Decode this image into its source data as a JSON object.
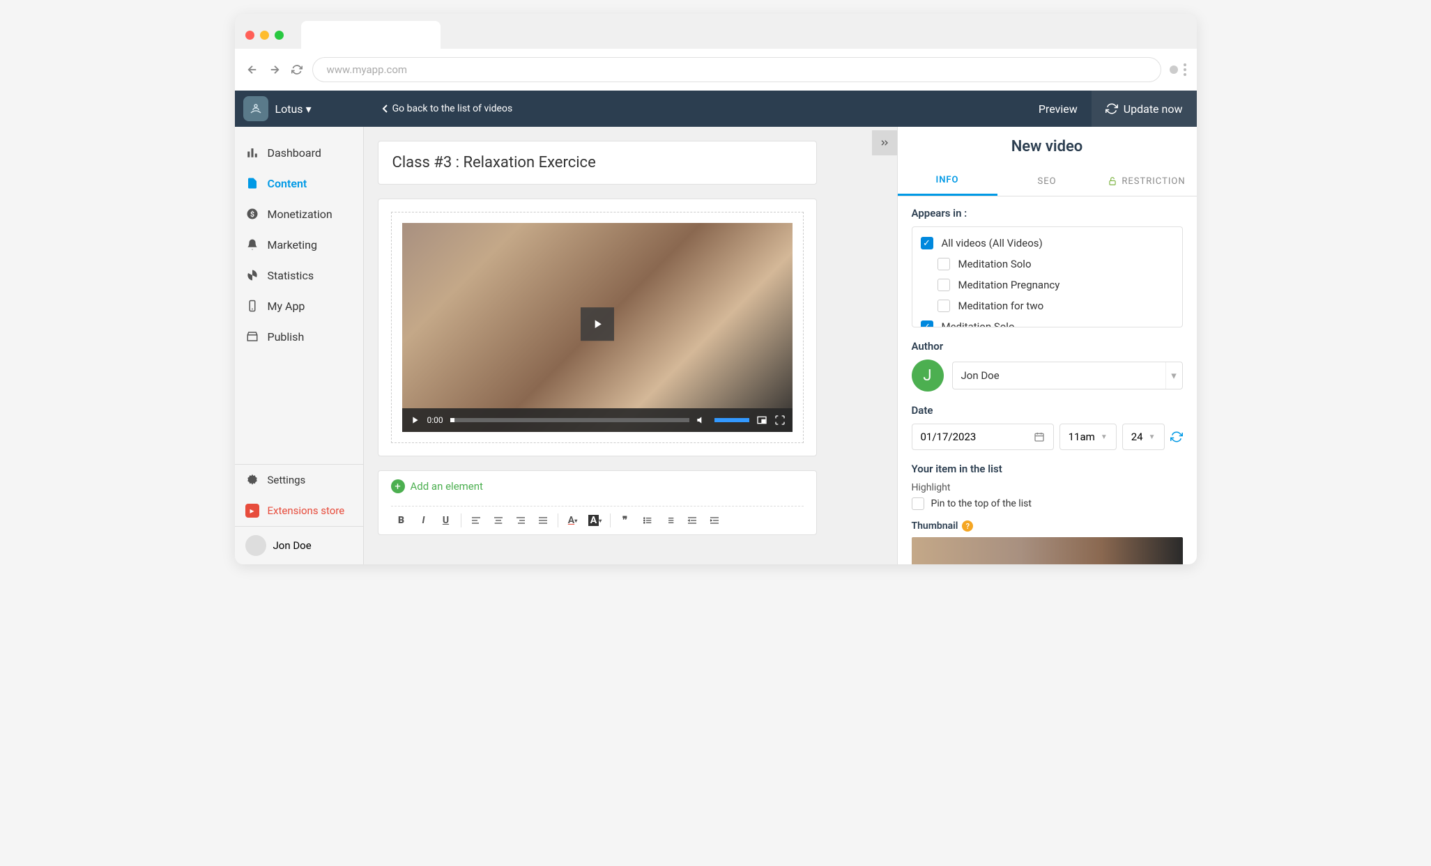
{
  "browser": {
    "url": "www.myapp.com"
  },
  "topbar": {
    "app_name": "Lotus",
    "back_link": "Go back to the list of videos",
    "preview": "Preview",
    "update": "Update now"
  },
  "sidebar": {
    "items": [
      {
        "label": "Dashboard",
        "icon": "bar-chart"
      },
      {
        "label": "Content",
        "icon": "document",
        "active": true
      },
      {
        "label": "Monetization",
        "icon": "dollar"
      },
      {
        "label": "Marketing",
        "icon": "bell"
      },
      {
        "label": "Statistics",
        "icon": "pie"
      },
      {
        "label": "My App",
        "icon": "phone"
      },
      {
        "label": "Publish",
        "icon": "store"
      }
    ],
    "settings": "Settings",
    "extensions": "Extensions store",
    "user": "Jon Doe"
  },
  "main": {
    "title": "Class #3 : Relaxation Exercice",
    "video_time": "0:00",
    "add_element": "Add an element"
  },
  "panel": {
    "title": "New video",
    "tabs": {
      "info": "INFO",
      "seo": "SEO",
      "restriction": "RESTRICTION"
    },
    "appears_in": "Appears in :",
    "categories": [
      {
        "label": "All videos (All Videos)",
        "checked": true,
        "indent": false
      },
      {
        "label": "Meditation Solo",
        "checked": false,
        "indent": true
      },
      {
        "label": "Meditation Pregnancy",
        "checked": false,
        "indent": true
      },
      {
        "label": "Meditation for two",
        "checked": false,
        "indent": true
      },
      {
        "label": "Meditation Solo",
        "checked": true,
        "indent": false
      }
    ],
    "author_label": "Author",
    "author_initial": "J",
    "author_name": "Jon Doe",
    "date_label": "Date",
    "date_value": "01/17/2023",
    "date_hour": "11am",
    "date_minute": "24",
    "list_label": "Your item in the list",
    "highlight_label": "Highlight",
    "pin_label": "Pin to the top of the list",
    "thumbnail_label": "Thumbnail"
  }
}
